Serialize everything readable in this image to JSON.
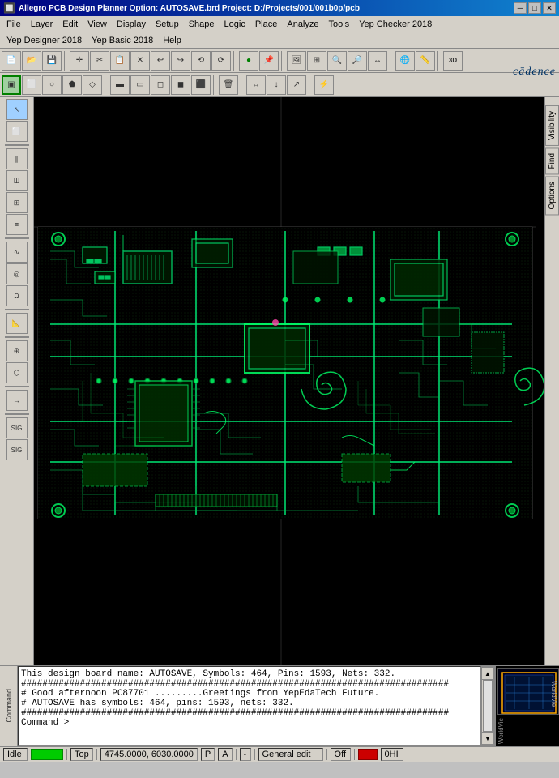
{
  "titlebar": {
    "title": "Allegro PCB Design Planner Option: AUTOSAVE.brd   Project: D:/Projects/001/001b0p/pcb",
    "minimize": "─",
    "maximize": "□",
    "close": "✕"
  },
  "menubar": {
    "items": [
      "File",
      "Layer",
      "Edit",
      "View",
      "Display",
      "Setup",
      "Shape",
      "Logic",
      "Place",
      "Analyze",
      "Tools",
      "Yep Checker 2018"
    ]
  },
  "menubar2": {
    "items": [
      "Yep Designer 2018",
      "Yep Basic 2018",
      "Help"
    ],
    "logo": "cādence"
  },
  "rightpanel": {
    "tabs": [
      "Visibility",
      "Find",
      "Options"
    ]
  },
  "console": {
    "label": "Command",
    "lines": [
      "This design board name: AUTOSAVE, Symbols: 464, Pins: 1593, Nets: 332.",
      "################################################################################",
      "# Good afternoon PC87701       .........Greetings from YepEdaTech Future.",
      "# AUTOSAVE has symbols: 464, pins: 1593, nets: 332.",
      "################################################################################",
      "Command >"
    ]
  },
  "minimap": {
    "label": "WorldVie"
  },
  "statusbar": {
    "idle": "Idle",
    "mode": "Top",
    "coords": "4745.0000, 6030.0000",
    "pa_indicator": "P",
    "al_indicator": "A",
    "dash": "-",
    "general_edit": "General edit",
    "off": "Off",
    "indicator": "0HI"
  },
  "toolbars": {
    "row1_icons": [
      "📂",
      "💾",
      "🖨",
      "✂",
      "📋",
      "↩",
      "↪",
      "⟲",
      "⟳",
      "🔲",
      "📌",
      "📌",
      "📷",
      "🔍",
      "🔍+",
      "🔍-",
      "🔃",
      "⬛",
      "📐",
      "3D"
    ],
    "row2_icons": [
      "⬛",
      "📐",
      "○",
      "◻",
      "◇",
      "◼",
      "▭",
      "◻",
      "◻",
      "⬜",
      "🗑",
      "↔",
      "↑",
      "→"
    ]
  },
  "sidebar_icons": [
    "↖",
    "⬜",
    "∥",
    "Ш",
    "🔲",
    "≡",
    "∿",
    "◎",
    "𝛺",
    "📐",
    "📍",
    "⬡",
    "→"
  ]
}
